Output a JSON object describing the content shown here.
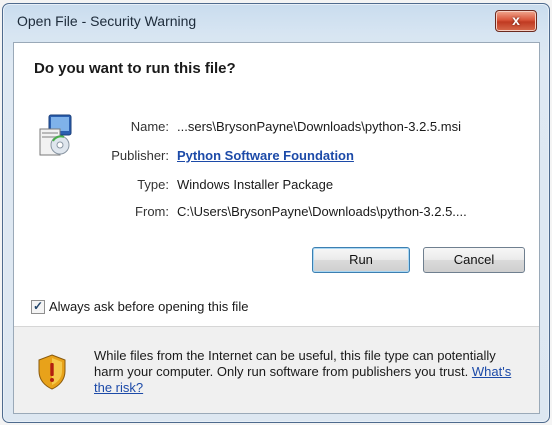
{
  "window": {
    "title": "Open File - Security Warning",
    "close_glyph": "x"
  },
  "dialog": {
    "question": "Do you want to run this file?",
    "icon": "installer-file-icon",
    "fields": {
      "name_label": "Name:",
      "name_value": "...sers\\BrysonPayne\\Downloads\\python-3.2.5.msi",
      "publisher_label": "Publisher:",
      "publisher_value": "Python Software Foundation",
      "type_label": "Type:",
      "type_value": "Windows Installer Package",
      "from_label": "From:",
      "from_value": "C:\\Users\\BrysonPayne\\Downloads\\python-3.2.5...."
    },
    "buttons": {
      "run": "Run",
      "cancel": "Cancel"
    },
    "checkbox": {
      "label": "Always ask before opening this file",
      "checked": true
    },
    "warning": {
      "icon": "shield-warning-icon",
      "text": "While files from the Internet can be useful, this file type can potentially harm your computer. Only run software from publishers you trust.",
      "link": "What's the risk?"
    }
  }
}
